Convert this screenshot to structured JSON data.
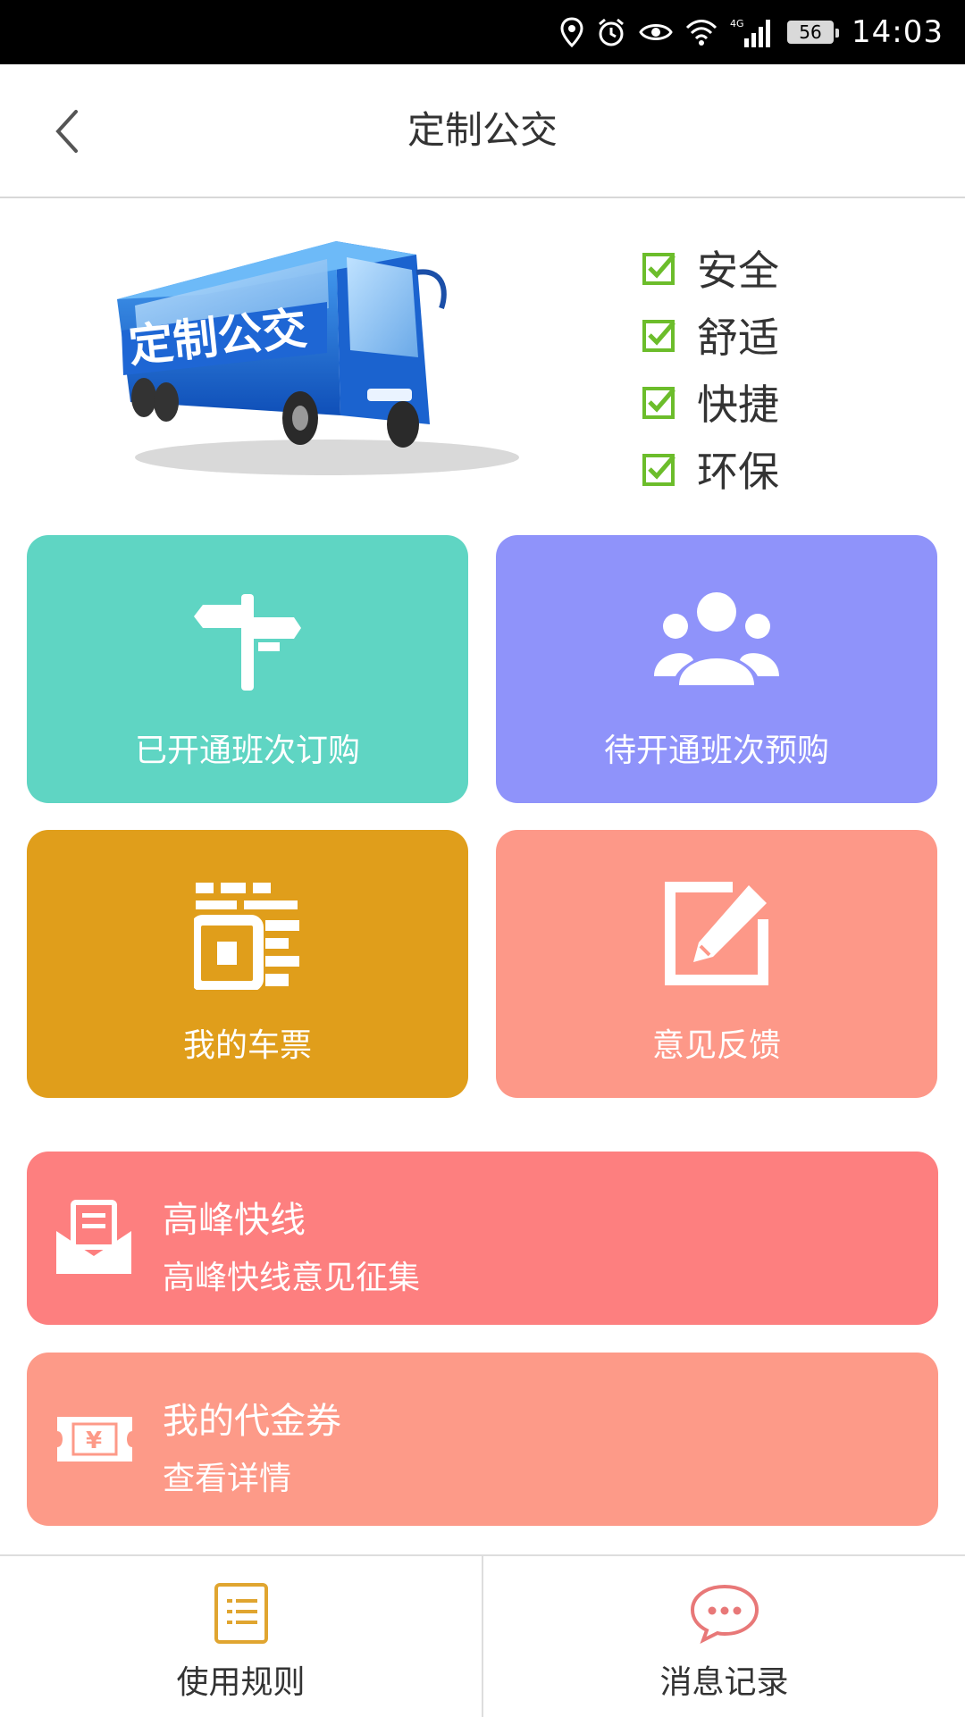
{
  "status_bar": {
    "battery": "56",
    "time": "14:03",
    "network": "4G"
  },
  "header": {
    "title": "定制公交"
  },
  "hero": {
    "bus_badge": "定制公交",
    "features": [
      "安全",
      "舒适",
      "快捷",
      "环保"
    ]
  },
  "tiles": [
    {
      "label": "已开通班次订购",
      "color": "#5fd5c3",
      "icon": "signpost-icon"
    },
    {
      "label": "待开通班次预购",
      "color": "#8f93fa",
      "icon": "people-group-icon"
    },
    {
      "label": "我的车票",
      "color": "#e09e1b",
      "icon": "ticket-qr-icon"
    },
    {
      "label": "意见反馈",
      "color": "#fd9888",
      "icon": "edit-icon"
    }
  ],
  "banners": [
    {
      "title": "高峰快线",
      "subtitle": "高峰快线意见征集",
      "color": "#fd7f7f",
      "icon": "mail-icon"
    },
    {
      "title": "我的代金券",
      "subtitle": "查看详情",
      "color": "#fd9a88",
      "icon": "voucher-icon"
    }
  ],
  "tabbar": [
    {
      "label": "使用规则",
      "icon": "rules-document-icon",
      "color": "#e0a530"
    },
    {
      "label": "消息记录",
      "icon": "chat-bubble-icon",
      "color": "#e87878"
    }
  ],
  "colors": {
    "check": "#6cbd2b",
    "bus_blue": "#1f6ed8"
  }
}
